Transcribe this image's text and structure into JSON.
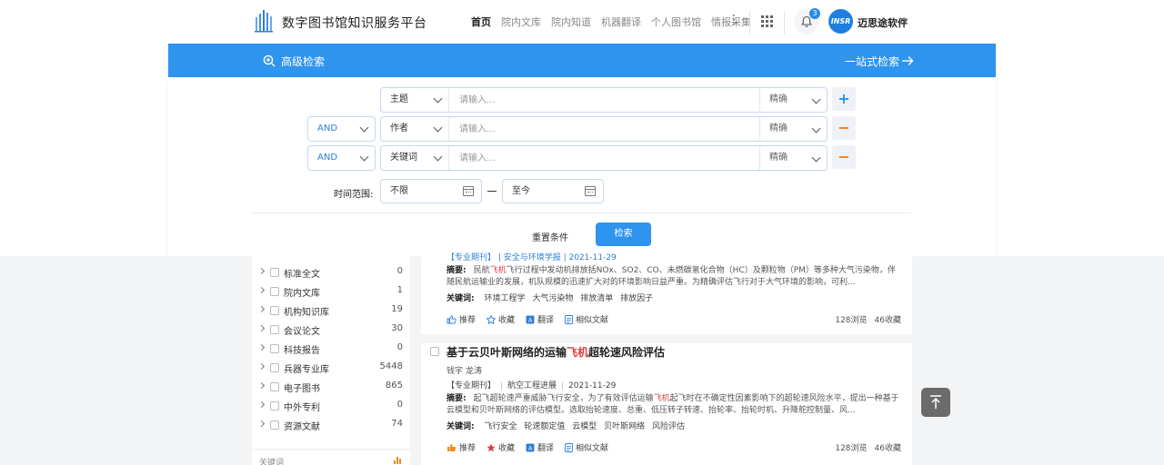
{
  "header": {
    "site_title": "数字图书馆知识服务平台",
    "nav": [
      "首页",
      "院内文库",
      "院内知道",
      "机器翻译",
      "个人图书馆",
      "情报采集"
    ],
    "notification_count": "3",
    "avatar_text": "INSR",
    "username": "迈思途软件"
  },
  "bluebar": {
    "advanced_search": "高级检索",
    "one_stop": "一站式检索"
  },
  "search": {
    "rows": [
      {
        "field": "主题",
        "placeholder": "请输入...",
        "match": "精确"
      },
      {
        "logic": "AND",
        "field": "作者",
        "placeholder": "请输入...",
        "match": "精确"
      },
      {
        "logic": "AND",
        "field": "关键词",
        "placeholder": "请输入...",
        "match": "精确"
      }
    ],
    "add_label": "+",
    "remove_label": "−",
    "time_label": "时间范围:",
    "from": "不限",
    "to": "至今",
    "reset": "重置条件",
    "submit": "检索"
  },
  "sidebar": {
    "items": [
      {
        "name": "标准全文",
        "count": "0"
      },
      {
        "name": "院内文库",
        "count": "1"
      },
      {
        "name": "机构知识库",
        "count": "19"
      },
      {
        "name": "会议论文",
        "count": "30"
      },
      {
        "name": "科技报告",
        "count": "0"
      },
      {
        "name": "兵器专业库",
        "count": "5448"
      },
      {
        "name": "电子图书",
        "count": "865"
      },
      {
        "name": "中外专利",
        "count": "0"
      },
      {
        "name": "资源文献",
        "count": "74"
      }
    ],
    "keyword_section": "关键词"
  },
  "results": [
    {
      "meta_cut": "【专业期刊】 | 安全与环境学报 | 2021-11-29",
      "abstract_label": "摘要:",
      "abstract_pre": "民航",
      "abstract_hl": "飞机",
      "abstract_post": "飞行过程中发动机排放括NOx、SO2、CO、未燃碳氢化合物（HC）及颗粒物（PM）等多种大气污染物，伴随民航运输业的发展，机队规模的迅速扩大对的环境影响日益严重。为精确评估飞行对于大气环境的影响，可利...",
      "keywords_label": "关键词:",
      "keywords": [
        "环境工程学",
        "大气污染物",
        "排放清单",
        "排放因子"
      ],
      "actions": {
        "like": "推荐",
        "fav": "收藏",
        "translate": "翻译",
        "similar": "相似文献"
      },
      "views": "128浏览",
      "favs": "46收藏"
    },
    {
      "title_pre": "基于云贝叶斯网络的运输",
      "title_hl": "飞机",
      "title_post": "超轮速风险评估",
      "authors": "钱宇  龙涛",
      "source_type": "【专业期刊】",
      "journal": "航空工程进展",
      "date": "2021-11-29",
      "abstract_label": "摘要:",
      "abstract_pre": "起飞超轮速严重威胁飞行安全，为了有效评估运输",
      "abstract_hl": "飞机",
      "abstract_post": "起飞时在不确定性因素影响下的超轮速风险水平，提出一种基于云模型和贝叶斯网络的评估模型。选取抬轮速度、总重、低压转子转速、抬轮率、抬轮时机、升降舵控制量、风...",
      "keywords_label": "关键词:",
      "keywords": [
        "飞行安全",
        "轮速额定值",
        "云模型",
        "贝叶斯网络",
        "风险评估"
      ],
      "actions": {
        "like": "推荐",
        "fav": "收藏",
        "translate": "翻译",
        "similar": "相似文献"
      },
      "views": "128浏览",
      "favs": "46收藏"
    }
  ],
  "colors": {
    "primary": "#2e94ee",
    "accent": "#ef7d1f",
    "highlight": "#e03a3a"
  }
}
